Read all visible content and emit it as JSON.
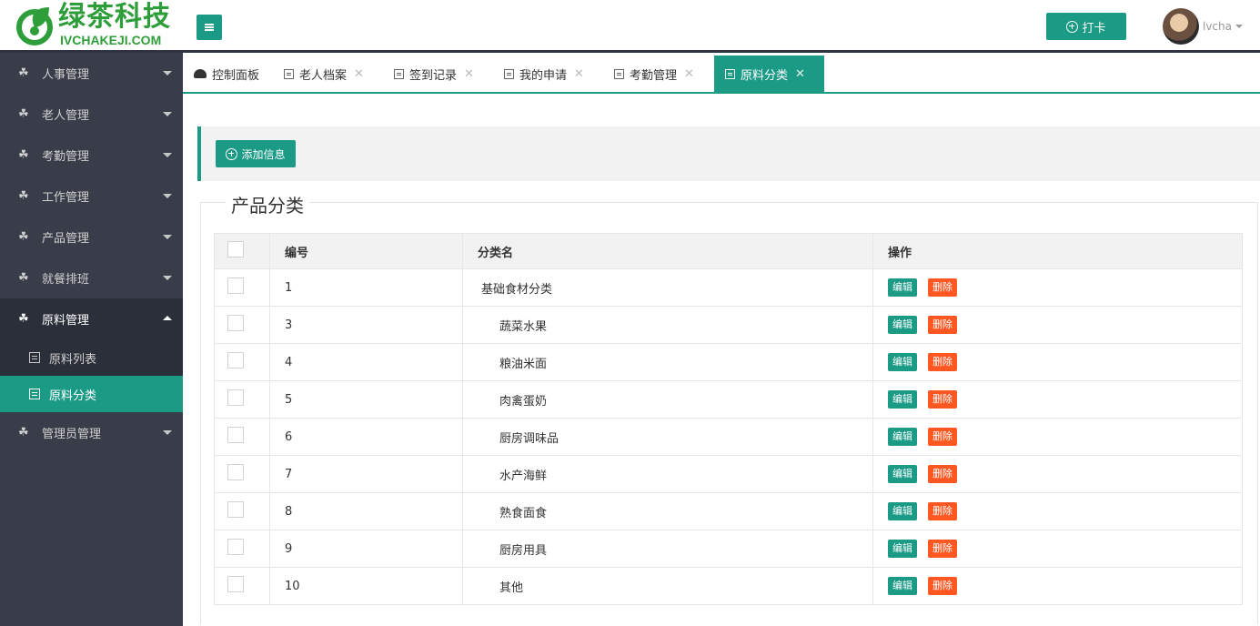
{
  "brand": {
    "name": "绿茶科技",
    "sub": "IVCHAKEJI.COM"
  },
  "header": {
    "punch_label": "打卡",
    "username": "lvcha"
  },
  "sidebar": {
    "items": [
      {
        "label": "人事管理"
      },
      {
        "label": "老人管理"
      },
      {
        "label": "考勤管理"
      },
      {
        "label": "工作管理"
      },
      {
        "label": "产品管理"
      },
      {
        "label": "就餐排班"
      },
      {
        "label": "原料管理",
        "open": true
      },
      {
        "label": "管理员管理"
      }
    ],
    "sub_items": [
      {
        "label": "原料列表"
      },
      {
        "label": "原料分类",
        "active": true
      }
    ]
  },
  "tabs": [
    {
      "label": "控制面板"
    },
    {
      "label": "老人档案"
    },
    {
      "label": "签到记录"
    },
    {
      "label": "我的申请"
    },
    {
      "label": "考勤管理"
    },
    {
      "label": "原料分类",
      "active": true
    }
  ],
  "toolbar": {
    "add_label": "添加信息"
  },
  "section": {
    "title": "产品分类"
  },
  "table": {
    "headers": {
      "id": "编号",
      "name": "分类名",
      "ops": "操作"
    },
    "edit_label": "编辑",
    "delete_label": "删除",
    "rows": [
      {
        "id": "1",
        "name": "基础食材分类",
        "level": 0
      },
      {
        "id": "3",
        "name": "蔬菜水果",
        "level": 1
      },
      {
        "id": "4",
        "name": "粮油米面",
        "level": 1
      },
      {
        "id": "5",
        "name": "肉禽蛋奶",
        "level": 1
      },
      {
        "id": "6",
        "name": "厨房调味品",
        "level": 1
      },
      {
        "id": "7",
        "name": "水产海鲜",
        "level": 1
      },
      {
        "id": "8",
        "name": "熟食面食",
        "level": 1
      },
      {
        "id": "9",
        "name": "厨房用具",
        "level": 1
      },
      {
        "id": "10",
        "name": "其他",
        "level": 1
      }
    ]
  },
  "colors": {
    "accent": "#1b9a86",
    "danger": "#ff5722",
    "sidebar_bg": "#393d49",
    "brand_green": "#2e9e3a"
  }
}
